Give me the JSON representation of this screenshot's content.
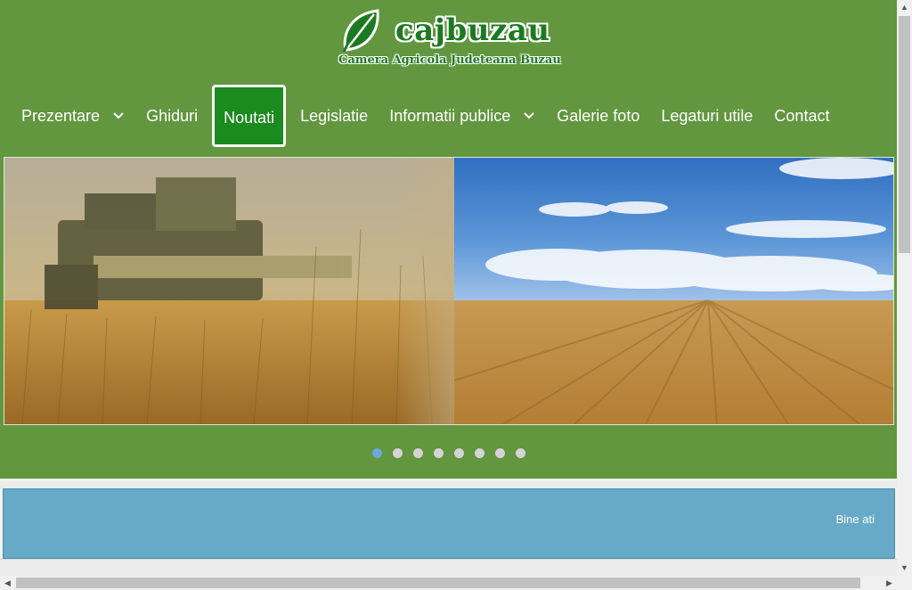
{
  "site": {
    "title": "cajbuzau",
    "subtitle": "Camera Agricola Judeteana Buzau"
  },
  "nav": {
    "items": [
      {
        "label": "Prezentare",
        "has_dropdown": true
      },
      {
        "label": "Ghiduri",
        "has_dropdown": false
      },
      {
        "label": "Noutati",
        "active": true
      },
      {
        "label": "Legislatie",
        "has_dropdown": false
      },
      {
        "label": "Informatii publice",
        "has_dropdown": true
      },
      {
        "label": "Galerie foto",
        "has_dropdown": false
      },
      {
        "label": "Legaturi utile",
        "has_dropdown": false
      },
      {
        "label": "Contact",
        "has_dropdown": false
      }
    ]
  },
  "slider": {
    "slide_count": 8,
    "active_index": 0
  },
  "welcome": {
    "text": "Bine ati"
  },
  "colors": {
    "header_bg": "#62963f",
    "active_nav": "#1b8a1f",
    "welcome_bg": "#67aac7",
    "brand_green": "#1c7a21"
  },
  "icons": {
    "logo": "leaf-icon",
    "dropdown": "chevron-down-icon"
  }
}
